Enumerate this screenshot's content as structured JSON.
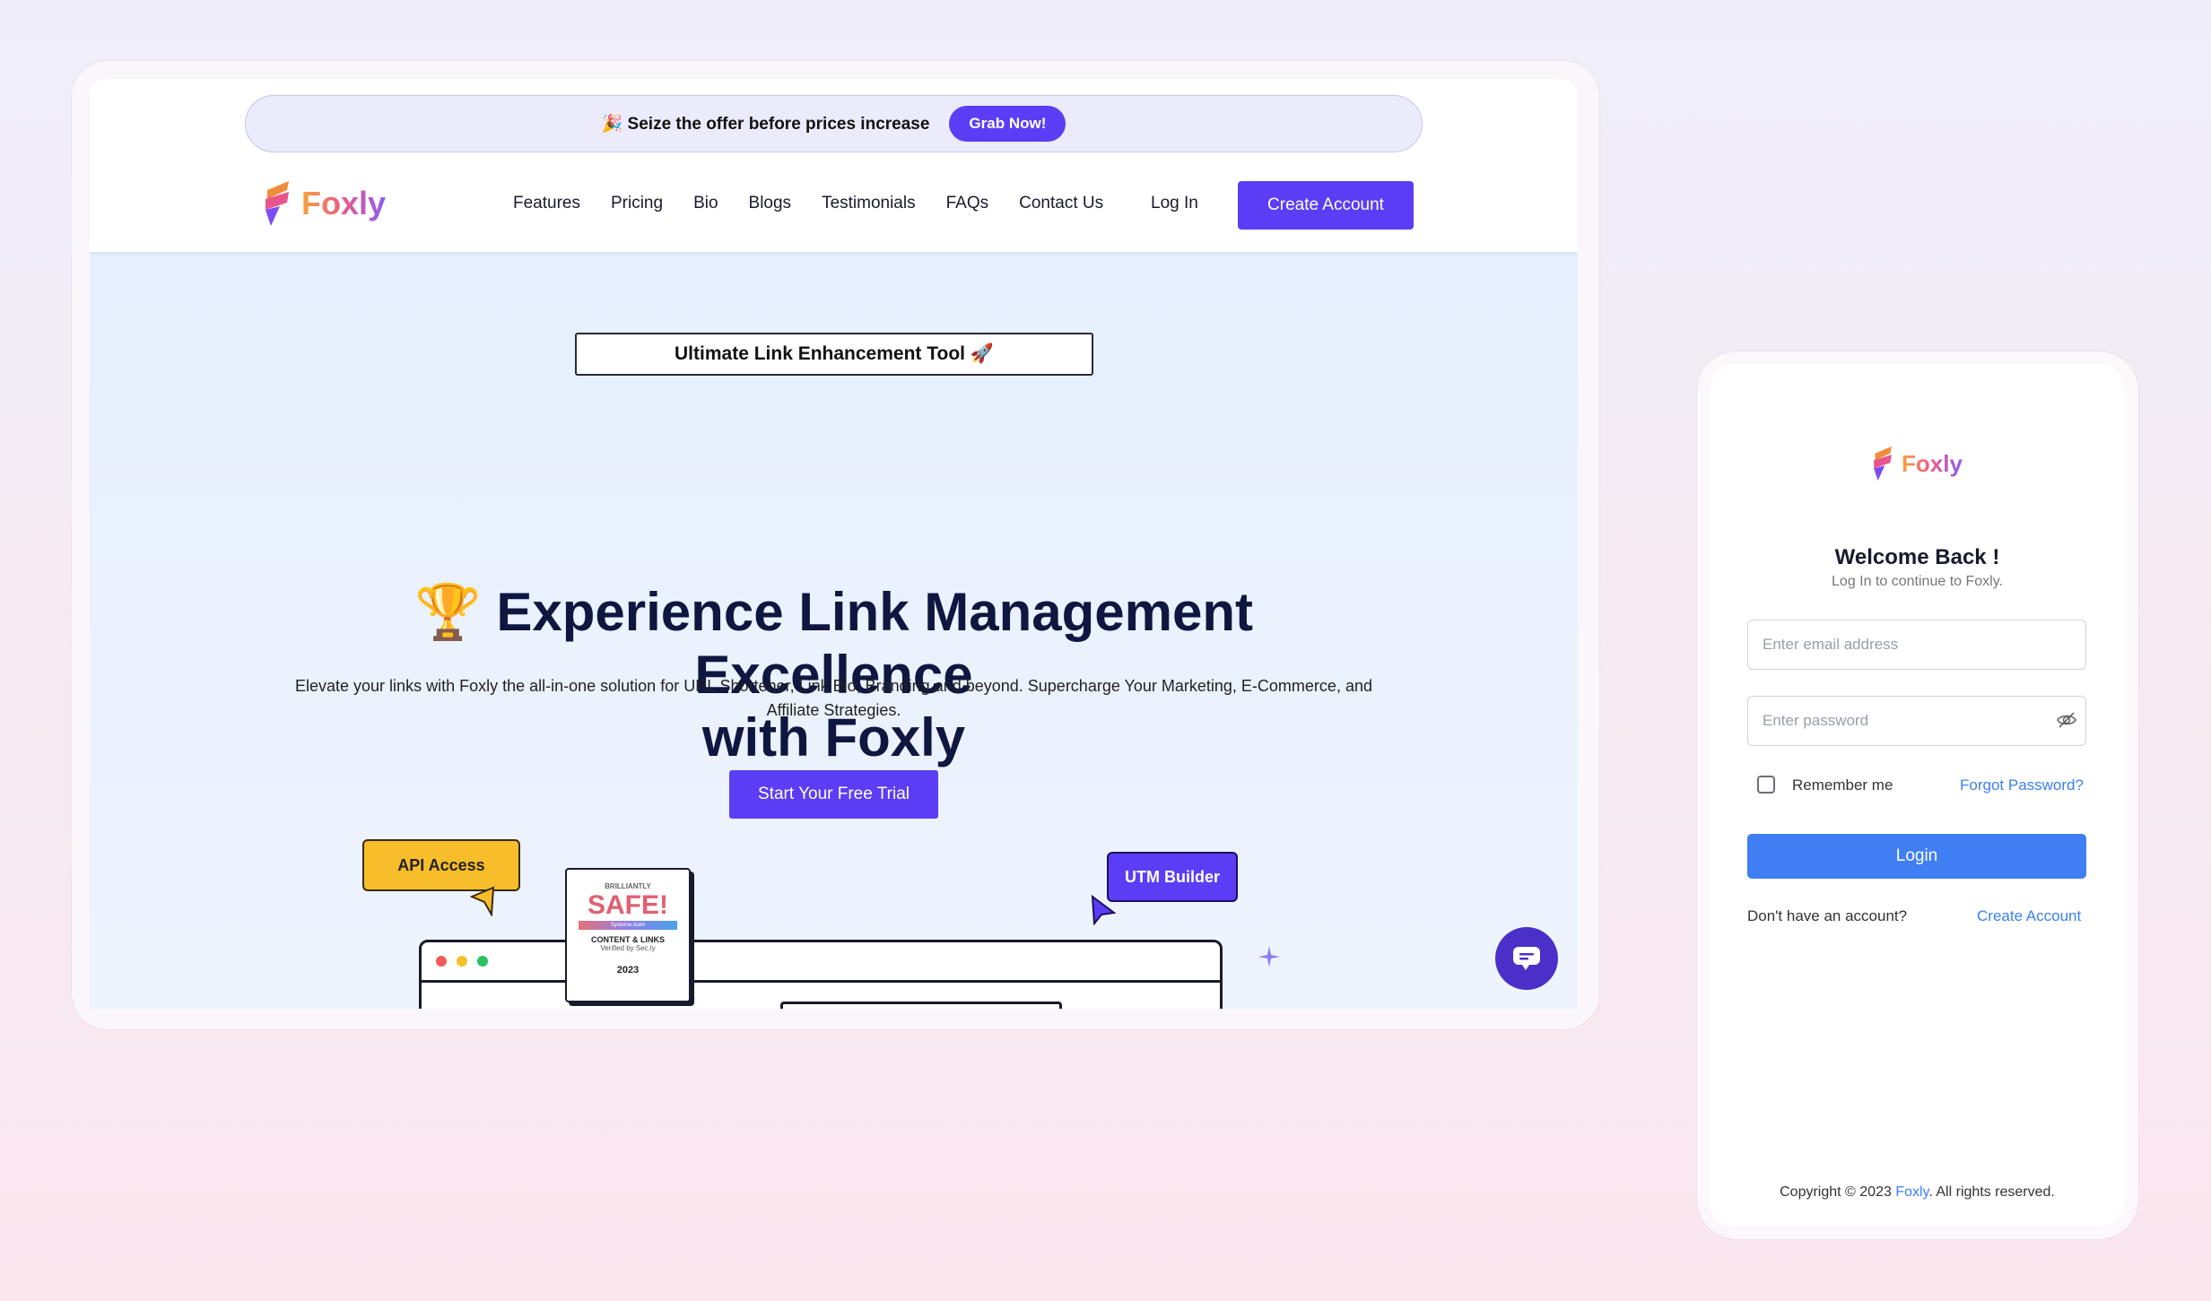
{
  "desktop": {
    "promo": {
      "text": "🎉 Seize the offer before prices increase",
      "button": "Grab Now!"
    },
    "logo": {
      "text": "Foxly"
    },
    "nav": [
      "Features",
      "Pricing",
      "Bio",
      "Blogs",
      "Testimonials",
      "FAQs",
      "Contact Us"
    ],
    "login": "Log In",
    "create_account": "Create Account",
    "hero": {
      "tag": "Ultimate Link Enhancement Tool 🚀",
      "headline_line1": "🏆 Experience Link Management Excellence",
      "headline_line2": "with Foxly",
      "subtitle_line1": "Elevate your links with Foxly the all-in-one solution for URL Shortener, Link Bio, Branding and beyond. Supercharge Your Marketing, E-Commerce, and",
      "subtitle_line2": "Affiliate Strategies.",
      "cta": "Start Your Free Trial"
    },
    "features": {
      "api": "API Access",
      "utm": "UTM Builder"
    },
    "badge": {
      "small": "BRILLIANTLY",
      "main": "SAFE!",
      "stripe": "Systeme.team",
      "category": "CONTENT & LINKS",
      "verified": "Verified by Sec.ly",
      "year": "2023"
    },
    "colors": {
      "primary": "#5b3df5",
      "hero_bg": "#e5effd",
      "text_dark": "#0f1640"
    }
  },
  "mobile": {
    "logo": {
      "text": "Foxly"
    },
    "welcome": "Welcome Back !",
    "subtitle": "Log In to continue to Foxly.",
    "email_placeholder": "Enter email address",
    "password_placeholder": "Enter password",
    "remember": "Remember me",
    "forgot": "Forgot Password?",
    "login_button": "Login",
    "no_account": "Don't have an account?",
    "create_account": "Create Account",
    "copyright_prefix": "Copyright © 2023 ",
    "copyright_brand": "Foxly",
    "copyright_suffix": ". All rights reserved.",
    "colors": {
      "button": "#3f7ff3",
      "link": "#3b7ff2"
    }
  }
}
